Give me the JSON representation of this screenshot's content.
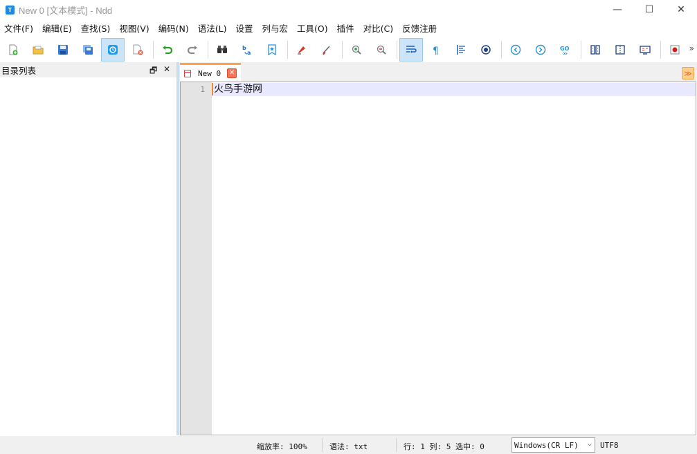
{
  "window": {
    "title": "New 0 [文本模式] - Ndd",
    "app_icon_letter": "T",
    "controls": {
      "minimize": "—",
      "maximize": "☐",
      "close": "✕"
    }
  },
  "menu": {
    "items": [
      "文件(F)",
      "编辑(E)",
      "查找(S)",
      "视图(V)",
      "编码(N)",
      "语法(L)",
      "设置",
      "列与宏",
      "工具(O)",
      "插件",
      "对比(C)",
      "反馈注册"
    ]
  },
  "toolbar": {
    "more": "»",
    "buttons": [
      {
        "name": "new-file-icon"
      },
      {
        "name": "open-folder-icon"
      },
      {
        "name": "save-icon"
      },
      {
        "name": "save-all-icon"
      },
      {
        "name": "auto-save-icon"
      },
      {
        "name": "close-file-icon"
      },
      {
        "name": "undo-icon"
      },
      {
        "name": "redo-icon"
      },
      {
        "name": "find-binoculars-icon"
      },
      {
        "name": "replace-icon"
      },
      {
        "name": "bookmark-icon"
      },
      {
        "name": "marker-icon"
      },
      {
        "name": "clear-mark-icon"
      },
      {
        "name": "zoom-in-icon"
      },
      {
        "name": "zoom-out-icon"
      },
      {
        "name": "word-wrap-icon"
      },
      {
        "name": "show-all-chars-icon"
      },
      {
        "name": "indent-guide-icon"
      },
      {
        "name": "target-icon"
      },
      {
        "name": "prev-icon"
      },
      {
        "name": "next-icon"
      },
      {
        "name": "goto-icon"
      },
      {
        "name": "compare-dir-icon"
      },
      {
        "name": "compare-file-icon"
      },
      {
        "name": "compare-bin-icon"
      },
      {
        "name": "record-macro-icon"
      }
    ]
  },
  "left_panel": {
    "title": "目录列表",
    "restore_glyph": "🗗",
    "close_glyph": "✕"
  },
  "tabs": [
    {
      "label": "New 0",
      "close_glyph": "✕",
      "active": true
    }
  ],
  "tab_menu_glyph": "≫",
  "editor": {
    "lines": [
      {
        "number": "1",
        "text": "火鸟手游网"
      }
    ]
  },
  "status": {
    "zoom": "缩放率: 100%",
    "syntax": "语法: txt",
    "position": "行: 1 列: 5 选中: 0",
    "eol_select": "Windows(CR LF)",
    "encoding": "UTF8"
  },
  "colors": {
    "tab_accent": "#ffa348",
    "close_button": "#f6765a",
    "current_line": "#e8e8ff",
    "gutter": "#e4e4e4",
    "toolbar_active": "#cce4f7"
  }
}
